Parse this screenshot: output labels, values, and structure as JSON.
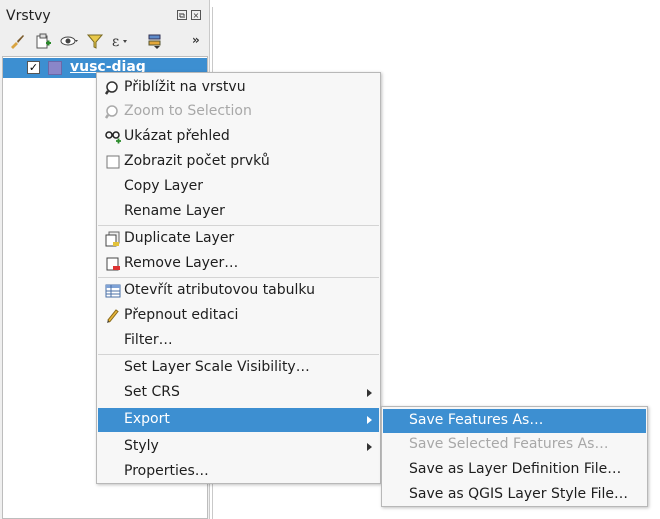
{
  "panel": {
    "title": "Vrstvy",
    "float_btn": "⧉",
    "close_btn": "×",
    "more_btn": "»"
  },
  "layer": {
    "name": "vusc-diag",
    "checked": "✓",
    "color": "#8a86c8"
  },
  "context_menu": {
    "items": [
      {
        "label": "Přiblížit na vrstvu",
        "icon": "zoom-icon",
        "enabled": true
      },
      {
        "label": "Zoom to Selection",
        "icon": "zoom-icon",
        "enabled": false
      },
      {
        "label": "Ukázat přehled",
        "icon": "glasses-plus-icon",
        "enabled": true
      },
      {
        "label": "Zobrazit počet prvků",
        "icon": "checkbox-icon",
        "enabled": true
      },
      {
        "label": "Copy Layer",
        "enabled": true
      },
      {
        "label": "Rename Layer",
        "enabled": true
      },
      {
        "label": "Duplicate Layer",
        "icon": "duplicate-layer-icon",
        "enabled": true
      },
      {
        "label": "Remove Layer…",
        "icon": "remove-layer-icon",
        "enabled": true
      },
      {
        "label": "Otevřít atributovou tabulku",
        "icon": "table-icon",
        "enabled": true
      },
      {
        "label": "Přepnout editaci",
        "icon": "pencil-icon",
        "enabled": true
      },
      {
        "label": "Filter…",
        "enabled": true
      },
      {
        "label": "Set Layer Scale Visibility…",
        "enabled": true
      },
      {
        "label": "Set CRS",
        "enabled": true,
        "submenu": true
      },
      {
        "label": "Export",
        "enabled": true,
        "submenu": true,
        "active": true
      },
      {
        "label": "Styly",
        "enabled": true,
        "submenu": true
      },
      {
        "label": "Properties…",
        "enabled": true
      }
    ]
  },
  "export_submenu": {
    "items": [
      {
        "label": "Save Features As…",
        "enabled": true,
        "active": true
      },
      {
        "label": "Save Selected Features As…",
        "enabled": false
      },
      {
        "label": "Save as Layer Definition File…",
        "enabled": true
      },
      {
        "label": "Save as QGIS Layer Style File…",
        "enabled": true
      }
    ]
  },
  "colors": {
    "highlight": "#3d8fd1",
    "menu_bg": "#f7f7f7",
    "panel_bg": "#efefef",
    "disabled_text": "#a8a8a8"
  }
}
